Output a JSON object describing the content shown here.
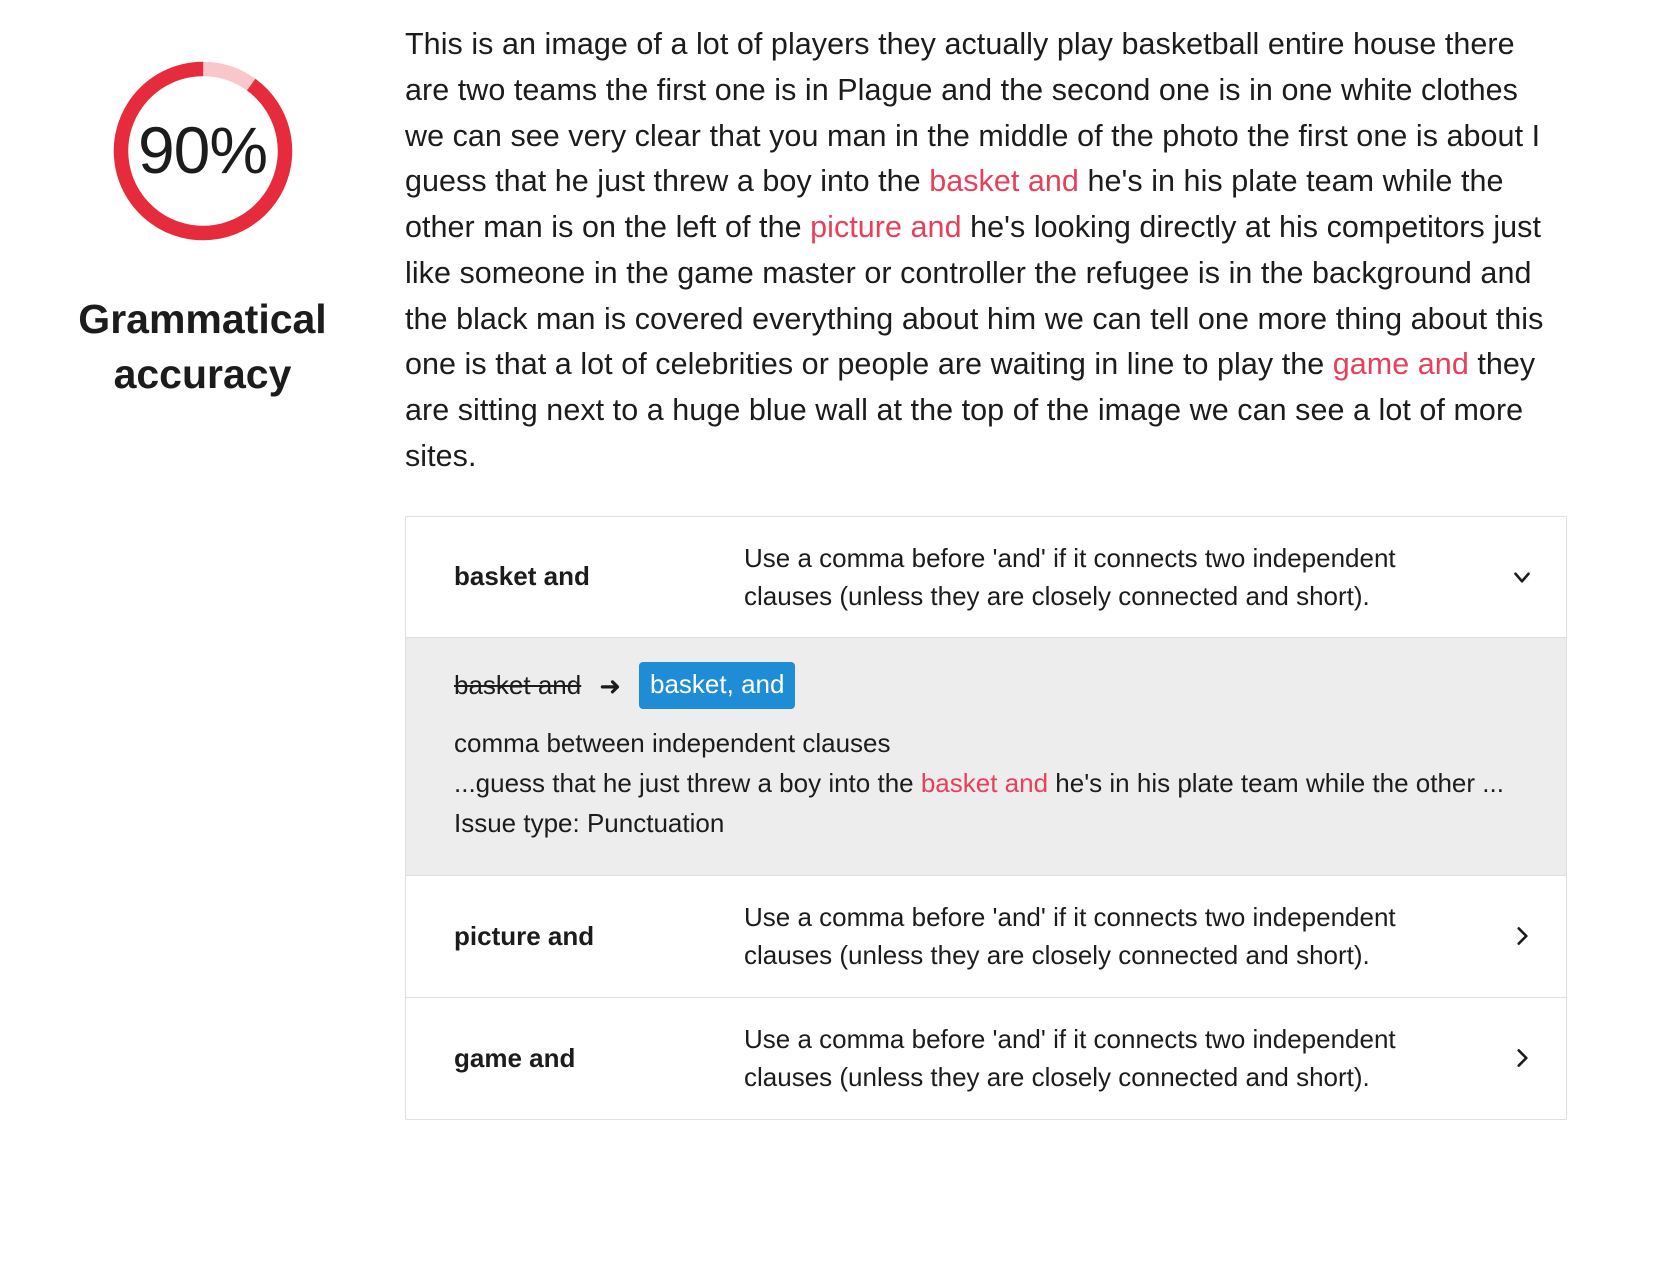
{
  "score": {
    "value_label": "90%",
    "percent": 90,
    "title": "Grammatical accuracy",
    "ring_color": "#e52b3c",
    "ring_track_color": "#f9c6cc"
  },
  "summary": {
    "segments": [
      {
        "text": "This is an image of a lot of players they actually play basketball entire house there are two teams the first one is in Plague and the second one is in one white clothes we can see very clear that you man in the middle of the photo the first one is about I guess that he just threw a boy into the ",
        "highlight": false
      },
      {
        "text": "basket and",
        "highlight": true
      },
      {
        "text": " he's in his plate team while the other man is on the left of the ",
        "highlight": false
      },
      {
        "text": "picture and",
        "highlight": true
      },
      {
        "text": " he's looking directly at his competitors just like someone in the game master or controller the refugee is in the background and the black man is covered everything about him we can tell one more thing about this one is that a lot of celebrities or people are waiting in line to play the ",
        "highlight": false
      },
      {
        "text": "game and",
        "highlight": true
      },
      {
        "text": " they are sitting next to a huge blue wall at the top of the image we can see a lot of more sites.",
        "highlight": false
      }
    ],
    "highlight_color": "#e8405a"
  },
  "issues": [
    {
      "term": "basket and",
      "description": "Use a comma before 'and' if it connects two independent clauses (unless they are closely connected and short).",
      "expanded": true,
      "chevron": "chevron-down-icon",
      "detail": {
        "original": "basket and",
        "arrow": "➜",
        "replacement": "basket, and",
        "replacement_color": "#1f8dd6",
        "short_message": "comma between independent clauses",
        "context_prefix": "...guess that he just threw a boy into the ",
        "context_highlight": "basket and",
        "context_suffix": " he's in his plate team while the other ...",
        "issue_type_label": "Issue type: Punctuation"
      }
    },
    {
      "term": "picture and",
      "description": "Use a comma before 'and' if it connects two independent clauses (unless they are closely connected and short).",
      "expanded": false,
      "chevron": "chevron-right-icon"
    },
    {
      "term": "game and",
      "description": "Use a comma before 'and' if it connects two independent clauses (unless they are closely connected and short).",
      "expanded": false,
      "chevron": "chevron-right-icon"
    }
  ]
}
